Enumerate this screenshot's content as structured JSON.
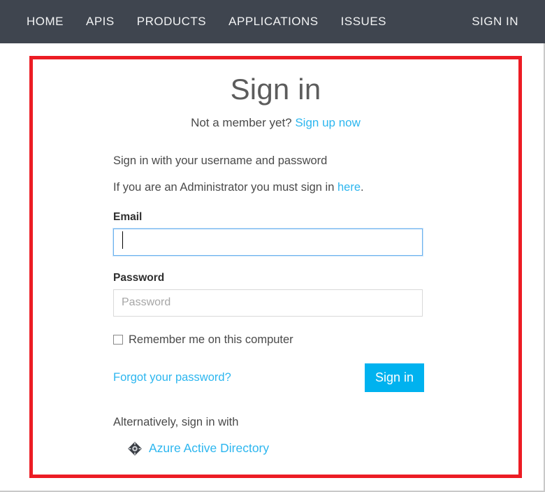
{
  "navbar": {
    "background_color": "#3f454f",
    "text_color": "#f2f3f4",
    "left_items": [
      {
        "label": "HOME",
        "name": "nav-item-home"
      },
      {
        "label": "APIS",
        "name": "nav-item-apis"
      },
      {
        "label": "PRODUCTS",
        "name": "nav-item-products"
      },
      {
        "label": "APPLICATIONS",
        "name": "nav-item-applications"
      },
      {
        "label": "ISSUES",
        "name": "nav-item-issues"
      }
    ],
    "right_items": [
      {
        "label": "SIGN IN",
        "name": "nav-item-sign-in"
      }
    ]
  },
  "annotation": {
    "color": "#ec1c24",
    "shape": "rectangle"
  },
  "signin": {
    "heading": "Sign in",
    "not_member_prefix": "Not a member yet? ",
    "sign_up_link": "Sign up now",
    "intro_line_1": "Sign in with your username and password",
    "admin_line_prefix": "If you are an Administrator you must sign in ",
    "admin_line_link": "here",
    "admin_line_suffix": ".",
    "email": {
      "label": "Email",
      "value": "",
      "placeholder": "",
      "focused": true
    },
    "password": {
      "label": "Password",
      "value": "",
      "placeholder": "Password",
      "focused": false
    },
    "remember_me_label": "Remember me on this computer",
    "remember_me_checked": false,
    "forgot_password_link": "Forgot your password?",
    "submit_label": "Sign in",
    "submit_color": "#00b2ef",
    "alternative_label": "Alternatively, sign in with",
    "alternative_providers": [
      {
        "label": "Azure Active Directory",
        "icon": "azure-active-directory-icon"
      }
    ],
    "link_color": "#2cb6ef"
  }
}
